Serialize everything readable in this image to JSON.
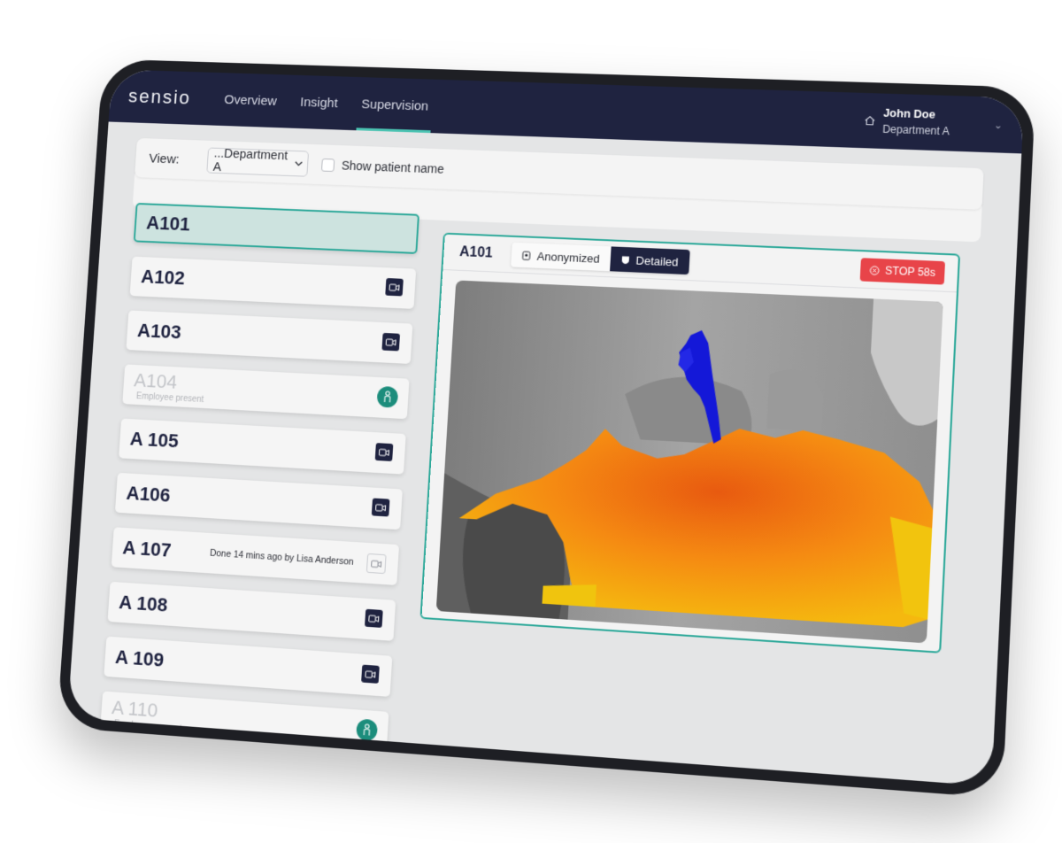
{
  "app": {
    "logo": "sensio",
    "nav": [
      {
        "label": "Overview",
        "active": false
      },
      {
        "label": "Insight",
        "active": false
      },
      {
        "label": "Supervision",
        "active": true
      }
    ],
    "user": {
      "name": "John Doe",
      "department": "Department A"
    }
  },
  "filter": {
    "view_label": "View:",
    "department_value": "...Department A",
    "show_patient_label": "Show patient name",
    "show_patient_checked": false
  },
  "rooms": [
    {
      "label": "A101",
      "state": "selected"
    },
    {
      "label": "A102",
      "state": "camera"
    },
    {
      "label": "A103",
      "state": "camera"
    },
    {
      "label": "A104",
      "state": "employee",
      "sub": "Employee present"
    },
    {
      "label": "A 105",
      "state": "camera"
    },
    {
      "label": "A106",
      "state": "camera"
    },
    {
      "label": "A 107",
      "state": "done",
      "note": "Done 14 mins ago by Lisa Anderson"
    },
    {
      "label": "A 108",
      "state": "camera"
    },
    {
      "label": "A 109",
      "state": "camera"
    },
    {
      "label": "A 110",
      "state": "employee",
      "sub": "Employee present"
    }
  ],
  "panel": {
    "room": "A101",
    "modes": [
      {
        "label": "Anonymized",
        "active": false
      },
      {
        "label": "Detailed",
        "active": true
      }
    ],
    "stop_label": "STOP 58s"
  },
  "colors": {
    "nav_bg": "#1f2340",
    "accent": "#2ea99a",
    "stop": "#e84449",
    "employee": "#1c8d7c"
  },
  "icons": {
    "camera": "video-camera-icon",
    "person": "person-icon",
    "home": "home-icon",
    "stop": "cancel-circle-icon"
  }
}
